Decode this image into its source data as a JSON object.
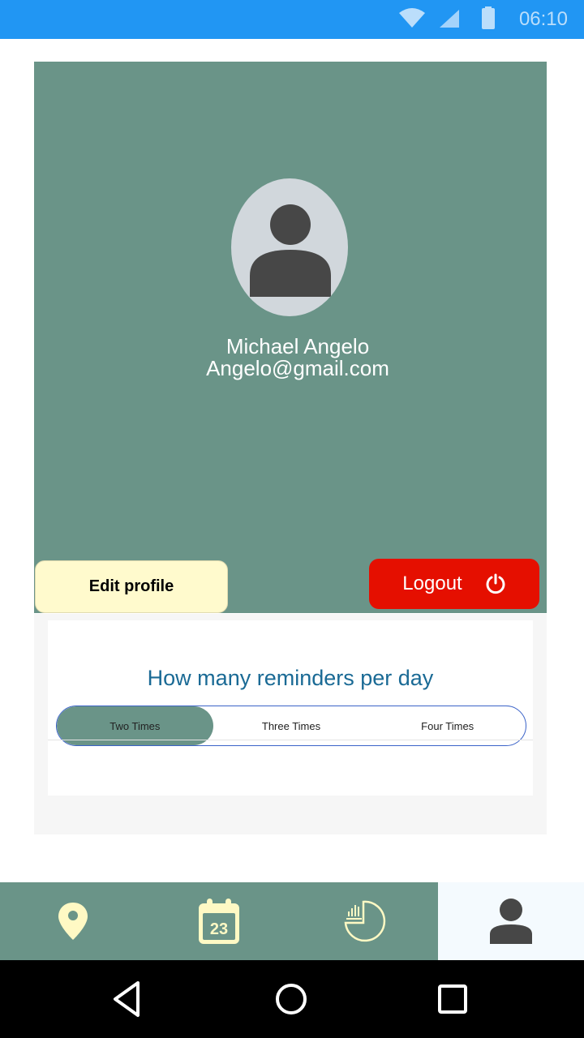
{
  "status_bar": {
    "time": "06:10",
    "icons": [
      "wifi-icon",
      "signal-icon",
      "battery-icon"
    ],
    "color": "#2196F3"
  },
  "profile": {
    "name": "Michael Angelo",
    "email": "Angelo@gmail.com",
    "card_color": "#6A9488",
    "edit_label": "Edit profile",
    "logout_label": "Logout",
    "logout_color": "#E50F00",
    "edit_color": "#FFFACD"
  },
  "reminders": {
    "title": "How many reminders per day",
    "options": [
      "Two Times",
      "Three Times",
      "Four Times"
    ],
    "selected": "Two Times"
  },
  "bottom_nav": {
    "items": [
      {
        "icon": "location-pin-icon"
      },
      {
        "icon": "calendar-icon",
        "day": "23"
      },
      {
        "icon": "chart-icon"
      },
      {
        "icon": "profile-icon"
      }
    ],
    "active_index": 3
  },
  "system_nav": {
    "icons": [
      "back-icon",
      "home-icon",
      "recents-icon"
    ]
  }
}
